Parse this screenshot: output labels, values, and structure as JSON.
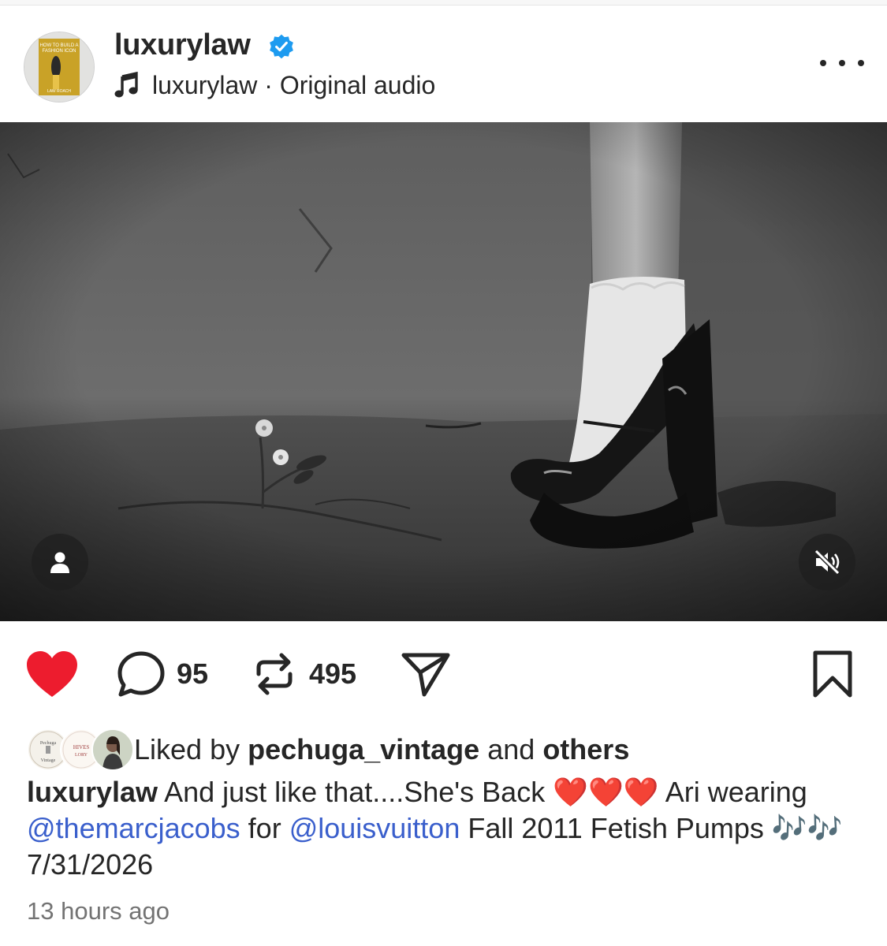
{
  "post": {
    "username": "luxurylaw",
    "audio": "luxurylaw · Original audio",
    "avatar_text": [
      "HOW TO BUILD A",
      "FASHION ICON",
      "LAW ROACH"
    ]
  },
  "actions": {
    "comments": "95",
    "reposts": "495"
  },
  "liked": {
    "prefix": "Liked by",
    "user": "pechuga_vintage",
    "middle": "and",
    "others": "others",
    "faces": [
      {
        "text": [
          "Pechuga",
          "Vintage"
        ]
      },
      {
        "text": [
          "HIVES",
          "LORY"
        ]
      },
      {
        "text": []
      }
    ]
  },
  "caption": {
    "username": "luxurylaw",
    "text1": "And just like that....She's Back",
    "hearts": "❤️❤️❤️",
    "text2": "Ari wearing",
    "mention1": "@themarcjacobs",
    "text3": "for",
    "mention2": "@louisvuitton",
    "text4": "Fall 2011 Fetish Pumps",
    "notes": "🎶🎶",
    "date": "7/31/2026"
  },
  "time_ago": "13 hours ago",
  "colors": {
    "heart": "#ed1c2e",
    "verified": "#1d9bf0",
    "mention": "#3a5fcc"
  }
}
